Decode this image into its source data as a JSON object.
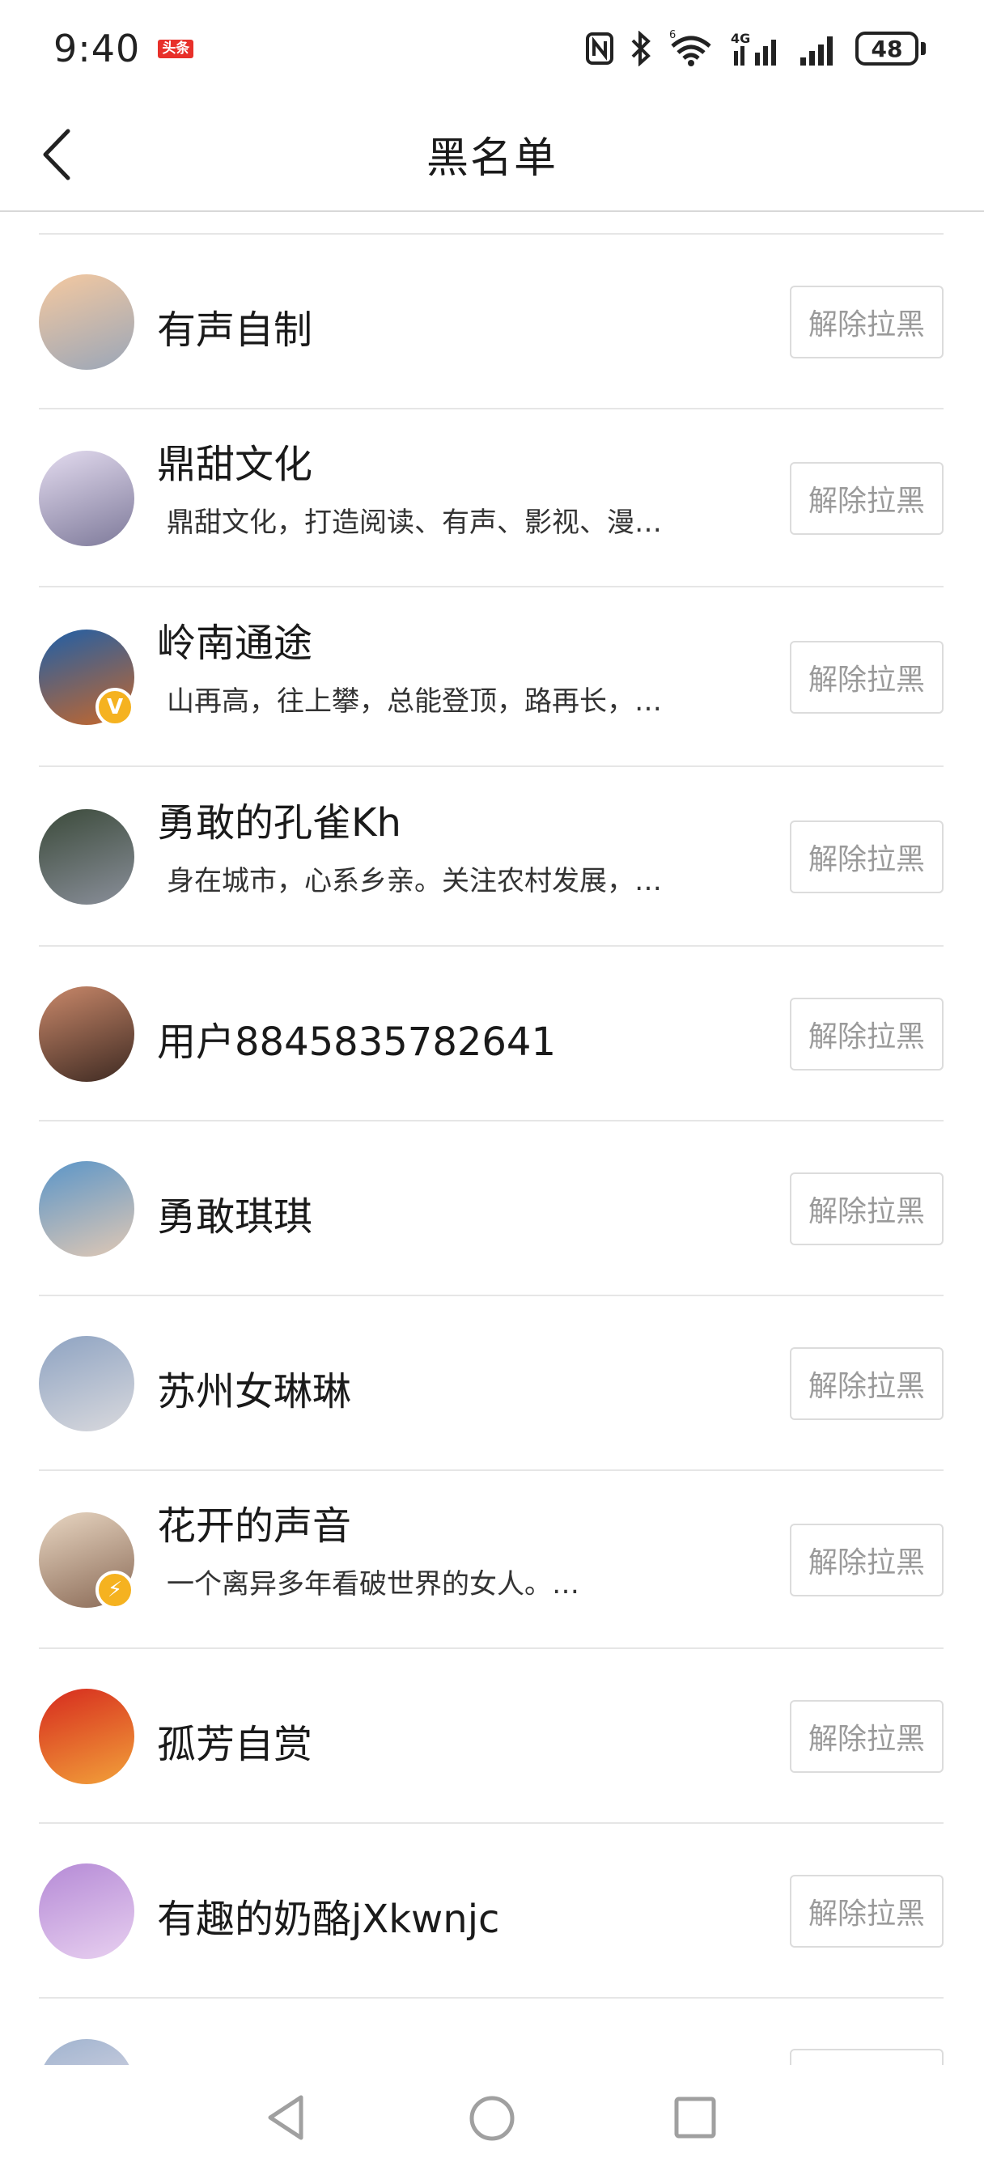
{
  "status_bar": {
    "time": "9:40",
    "app_badge": "头条",
    "network": "4G",
    "wifi_sup": "6",
    "battery": "48"
  },
  "header": {
    "title": "黑名单",
    "back_icon": "chevron-left-icon"
  },
  "unblock_label": "解除拉黑",
  "users": [
    {
      "name": "有声自制",
      "desc": "",
      "avatar_colors": [
        "#f5c9a0",
        "#9aa6b8"
      ],
      "badge": ""
    },
    {
      "name": "鼎甜文化",
      "desc": "鼎甜文化，打造阅读、有声、影视、漫…",
      "avatar_colors": [
        "#e3dbef",
        "#7e7a9a"
      ],
      "badge": ""
    },
    {
      "name": "岭南通途",
      "desc": "山再高，往上攀，总能登顶，路再长，…",
      "avatar_colors": [
        "#1e5fa8",
        "#c7672a"
      ],
      "badge": "V"
    },
    {
      "name": "勇敢的孔雀Kh",
      "desc": "身在城市，心系乡亲。关注农村发展，…",
      "avatar_colors": [
        "#3b4a3a",
        "#8a8f9a"
      ],
      "badge": ""
    },
    {
      "name": "用户8845835782641",
      "desc": "",
      "avatar_colors": [
        "#c9886a",
        "#3e2a22"
      ],
      "badge": ""
    },
    {
      "name": "勇敢琪琪",
      "desc": "",
      "avatar_colors": [
        "#5a95c8",
        "#e0c8b4"
      ],
      "badge": ""
    },
    {
      "name": "苏州女琳琳",
      "desc": "",
      "avatar_colors": [
        "#8ea3c2",
        "#d9d9dd"
      ],
      "badge": ""
    },
    {
      "name": "花开的声音",
      "desc": "一个离异多年看破世界的女人。…",
      "avatar_colors": [
        "#e8d6c2",
        "#8a6a56"
      ],
      "badge": "⚡"
    },
    {
      "name": "孤芳自赏",
      "desc": "",
      "avatar_colors": [
        "#d62a1e",
        "#f2a23a"
      ],
      "badge": ""
    },
    {
      "name": "有趣的奶酪jXkwnjc",
      "desc": "",
      "avatar_colors": [
        "#b58ad6",
        "#e8d0f0"
      ],
      "badge": ""
    }
  ],
  "colors": {
    "badge_v": "#f5b220",
    "badge_bolt": "#f5b220",
    "divider": "#e6e6e6",
    "button_text": "#9a9a9a"
  },
  "nav_bar": {
    "back": "triangle-back-icon",
    "home": "circle-home-icon",
    "recents": "square-recents-icon"
  }
}
